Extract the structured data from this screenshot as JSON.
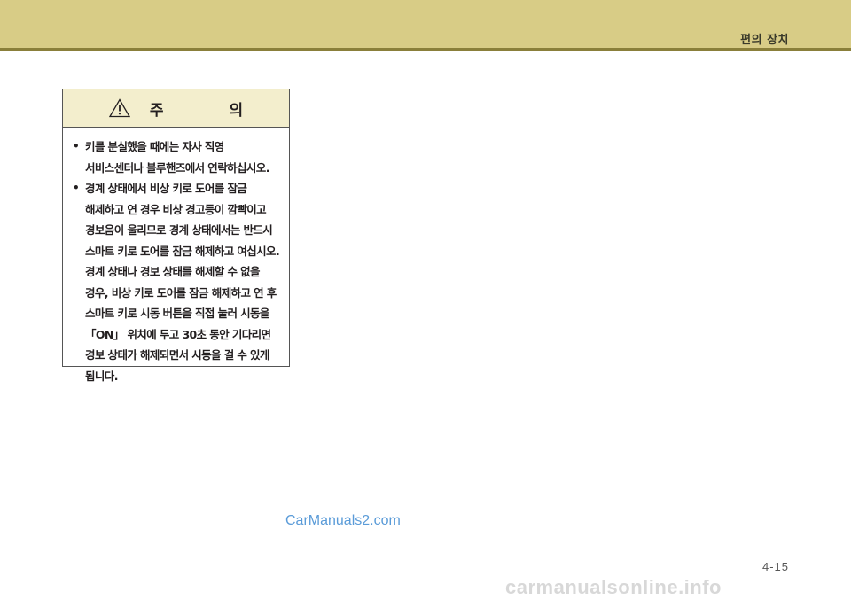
{
  "header": {
    "section_title": "편의 장치",
    "band_color": "#d8cc86",
    "rule_color": "#8a7f3a"
  },
  "caution": {
    "icon": "warning-triangle-icon",
    "title": "주 의",
    "items": [
      {
        "bullet": "•",
        "text": "키를 분실했을 때에는 자사 직영 서비스센터나 블루핸즈에서 연락하십시오."
      },
      {
        "bullet": "•",
        "text": "경계 상태에서 비상 키로 도어를 잠금 해제하고 연 경우 비상 경고등이 깜빡이고 경보음이 울리므로 경계 상태에서는 반드시 스마트 키로 도어를 잠금 해제하고 여십시오. 경계 상태나 경보 상태를 해제할 수 없을 경우, 비상 키로 도어를 잠금 해제하고 연 후 스마트 키로 시동 버튼을 직접 눌러 시동을 「ON」 위치에 두고 30초 동안 기다리면 경보 상태가 해제되면서 시동을 걸 수 있게 됩니다."
      }
    ]
  },
  "watermark_top": "CarManuals2.com",
  "page_number": "4-15",
  "watermark_bottom": "carmanualsonline.info"
}
